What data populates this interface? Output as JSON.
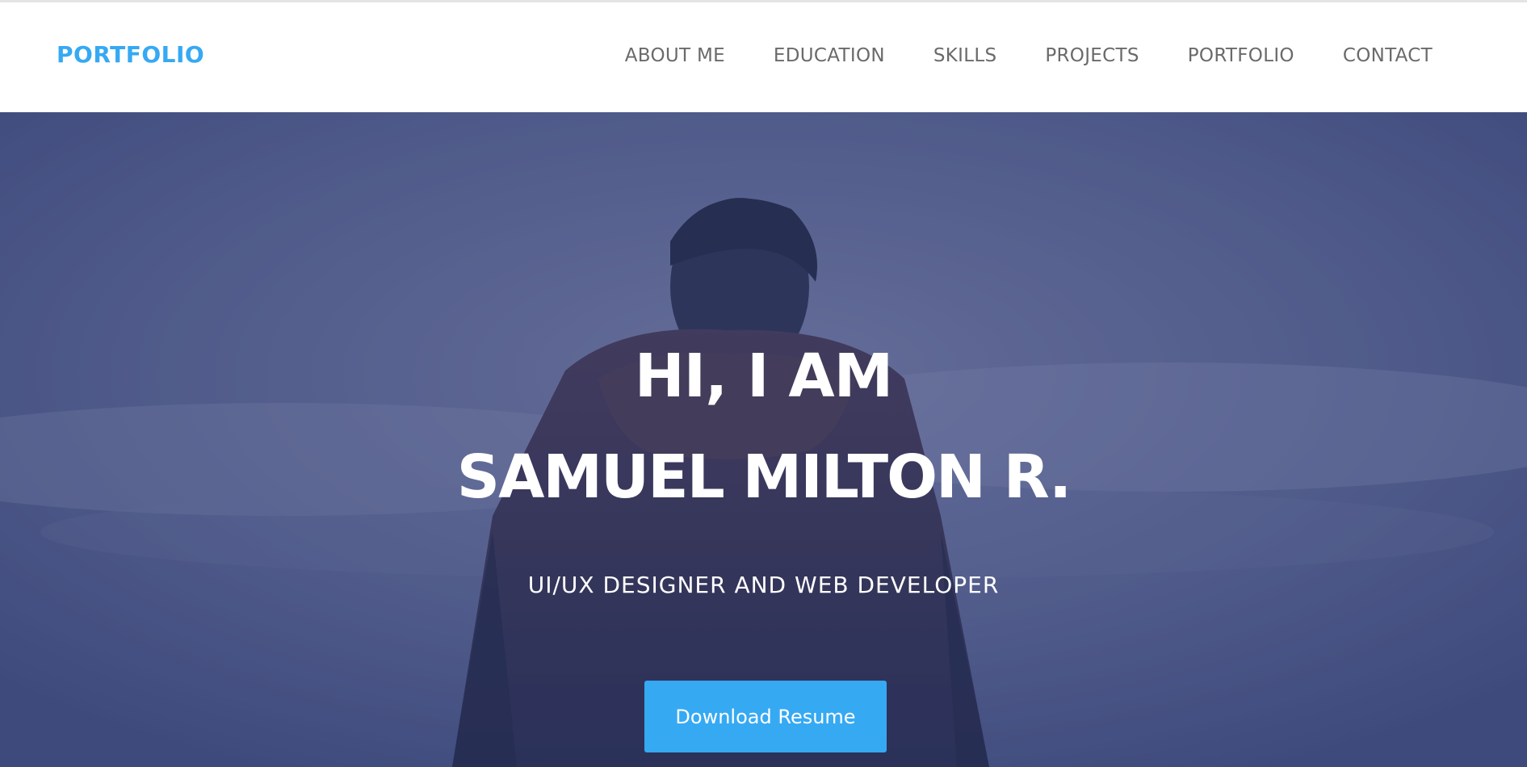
{
  "header": {
    "brand": "PORTFOLIO",
    "nav": [
      {
        "label": "ABOUT ME"
      },
      {
        "label": "EDUCATION"
      },
      {
        "label": "SKILLS"
      },
      {
        "label": "PROJECTS"
      },
      {
        "label": "PORTFOLIO"
      },
      {
        "label": "CONTACT"
      }
    ]
  },
  "hero": {
    "greeting": "HI, I AM",
    "name": "SAMUEL MILTON R.",
    "role": "UI/UX DESIGNER AND WEB DEVELOPER",
    "cta_label": "Download Resume"
  },
  "colors": {
    "accent": "#36a9f3",
    "nav_text": "#6a6a6a",
    "hero_tint": "#5a6488"
  }
}
